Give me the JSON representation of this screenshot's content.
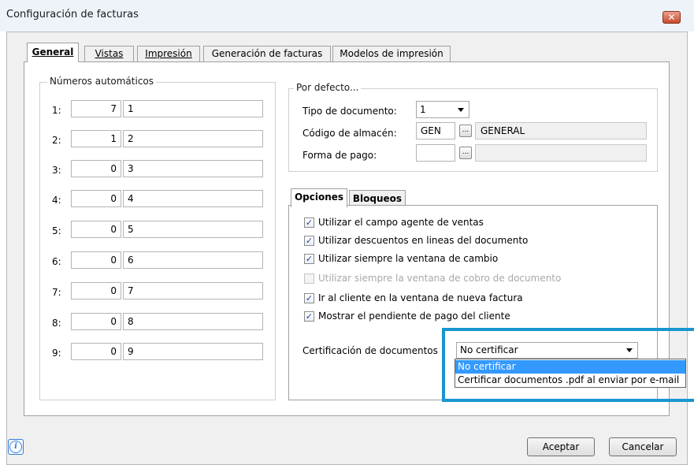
{
  "window": {
    "title": "Configuración de facturas",
    "close_glyph": "✕"
  },
  "tabs": [
    {
      "label": "General"
    },
    {
      "label": "Vistas"
    },
    {
      "label": "Impresión"
    },
    {
      "label": "Generación de facturas"
    },
    {
      "label": "Modelos de impresión"
    }
  ],
  "numeros": {
    "title": "Números automáticos",
    "rows": [
      {
        "label": "1:",
        "count": "7",
        "value": "1"
      },
      {
        "label": "2:",
        "count": "1",
        "value": "2"
      },
      {
        "label": "3:",
        "count": "0",
        "value": "3"
      },
      {
        "label": "4:",
        "count": "0",
        "value": "4"
      },
      {
        "label": "5:",
        "count": "0",
        "value": "5"
      },
      {
        "label": "6:",
        "count": "0",
        "value": "6"
      },
      {
        "label": "7:",
        "count": "0",
        "value": "7"
      },
      {
        "label": "8:",
        "count": "0",
        "value": "8"
      },
      {
        "label": "9:",
        "count": "0",
        "value": "9"
      }
    ]
  },
  "defecto": {
    "title": "Por defecto...",
    "tipo_label": "Tipo de documento:",
    "tipo_value": "1",
    "almacen_label": "Código de almacén:",
    "almacen_code": "GEN",
    "almacen_name": "GENERAL",
    "pago_label": "Forma de pago:",
    "pago_code": "",
    "pago_name": "",
    "ellipsis": "..."
  },
  "inner_tabs": [
    {
      "label": "Opciones"
    },
    {
      "label": "Bloqueos"
    }
  ],
  "opciones": [
    {
      "label": "Utilizar el campo agente de ventas",
      "checked": true,
      "enabled": true
    },
    {
      "label": "Utilizar descuentos en lineas del documento",
      "checked": true,
      "enabled": true
    },
    {
      "label": "Utilizar siempre la ventana de cambio",
      "checked": true,
      "enabled": true
    },
    {
      "label": "Utilizar siempre la ventana de cobro de documento",
      "checked": false,
      "enabled": false
    },
    {
      "label": "Ir al cliente en la ventana de nueva factura",
      "checked": true,
      "enabled": true
    },
    {
      "label": "Mostrar el pendiente de pago del cliente",
      "checked": true,
      "enabled": true
    }
  ],
  "certificacion": {
    "label": "Certificación de documentos",
    "selected": "No certificar",
    "options": [
      "No certificar",
      "Certificar documentos .pdf al enviar por e-mail"
    ]
  },
  "buttons": {
    "aceptar": "Aceptar",
    "cancelar": "Cancelar"
  },
  "info_glyph": "i",
  "check_glyph": "✓",
  "colors": {
    "highlight": "#1896d0",
    "selection": "#3399ff"
  }
}
